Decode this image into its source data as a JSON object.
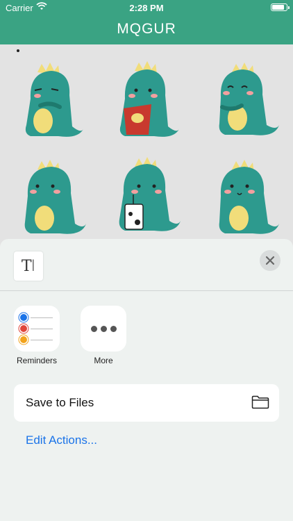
{
  "status": {
    "carrier": "Carrier",
    "time": "2:28 PM"
  },
  "nav": {
    "title": "MQGUR"
  },
  "sheet": {
    "preview_glyph": "T",
    "apps": [
      {
        "label": "Reminders",
        "icon": "reminders-icon"
      },
      {
        "label": "More",
        "icon": "more-icon"
      }
    ],
    "actions": [
      {
        "label": "Save to Files",
        "icon": "folder-icon"
      }
    ],
    "edit_actions": "Edit Actions..."
  },
  "colors": {
    "accent": "#3aa383",
    "dino": "#2d9a8e",
    "belly": "#f1dd7a",
    "link": "#1a73e8"
  },
  "stickers": [
    "dino-grumpy",
    "dino-chips",
    "dino-smug",
    "dino-sitting",
    "dino-milk",
    "dino-happy"
  ]
}
